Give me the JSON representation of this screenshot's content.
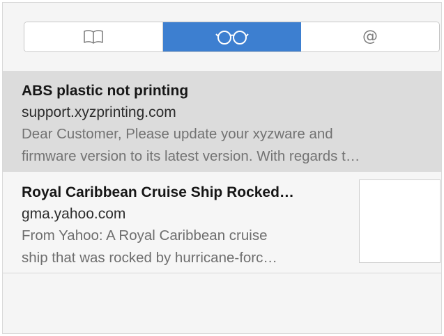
{
  "tabs": [
    {
      "name": "bookmarks",
      "icon": "book-icon",
      "active": false
    },
    {
      "name": "reading-list",
      "icon": "glasses-icon",
      "active": true
    },
    {
      "name": "shared-links",
      "icon": "at-sign-icon",
      "label": "@",
      "active": false
    }
  ],
  "colors": {
    "accent": "#3d7fd0",
    "selected_row": "#dcdcdc"
  },
  "reading_list": {
    "items": [
      {
        "title": "ABS plastic not printing",
        "domain": "support.xyzprinting.com",
        "line1": "Dear Customer, Please update your xyzware and",
        "line2": "firmware version to its latest version. With regards t…",
        "selected": true
      },
      {
        "title": "Royal Caribbean Cruise Ship Rocked…",
        "domain": "gma.yahoo.com",
        "line1": "From Yahoo: A Royal Caribbean cruise",
        "line2": "ship that was rocked by hurricane-forc…",
        "selected": false,
        "has_thumbnail": true
      }
    ]
  }
}
